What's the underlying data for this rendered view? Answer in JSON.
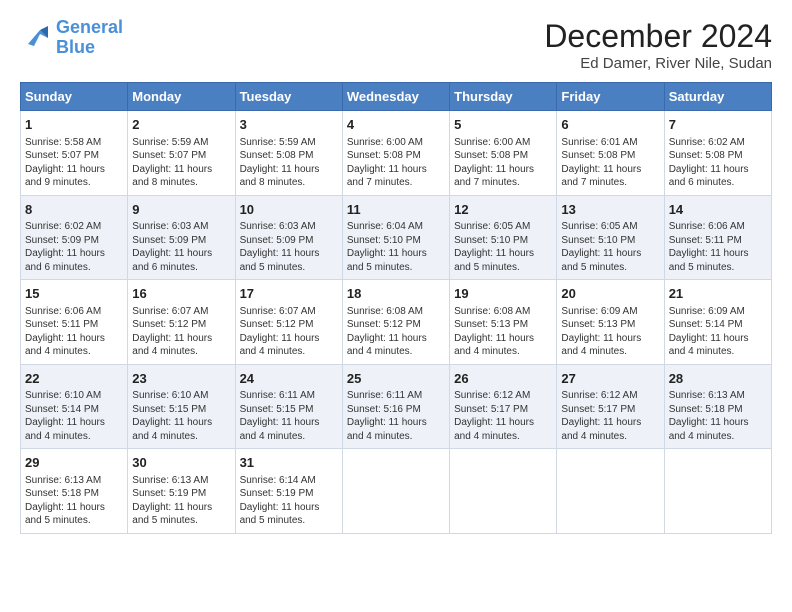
{
  "logo": {
    "line1": "General",
    "line2": "Blue"
  },
  "title": "December 2024",
  "subtitle": "Ed Damer, River Nile, Sudan",
  "days_of_week": [
    "Sunday",
    "Monday",
    "Tuesday",
    "Wednesday",
    "Thursday",
    "Friday",
    "Saturday"
  ],
  "weeks": [
    [
      {
        "day": "1",
        "info": "Sunrise: 5:58 AM\nSunset: 5:07 PM\nDaylight: 11 hours and 9 minutes."
      },
      {
        "day": "2",
        "info": "Sunrise: 5:59 AM\nSunset: 5:07 PM\nDaylight: 11 hours and 8 minutes."
      },
      {
        "day": "3",
        "info": "Sunrise: 5:59 AM\nSunset: 5:08 PM\nDaylight: 11 hours and 8 minutes."
      },
      {
        "day": "4",
        "info": "Sunrise: 6:00 AM\nSunset: 5:08 PM\nDaylight: 11 hours and 7 minutes."
      },
      {
        "day": "5",
        "info": "Sunrise: 6:00 AM\nSunset: 5:08 PM\nDaylight: 11 hours and 7 minutes."
      },
      {
        "day": "6",
        "info": "Sunrise: 6:01 AM\nSunset: 5:08 PM\nDaylight: 11 hours and 7 minutes."
      },
      {
        "day": "7",
        "info": "Sunrise: 6:02 AM\nSunset: 5:08 PM\nDaylight: 11 hours and 6 minutes."
      }
    ],
    [
      {
        "day": "8",
        "info": "Sunrise: 6:02 AM\nSunset: 5:09 PM\nDaylight: 11 hours and 6 minutes."
      },
      {
        "day": "9",
        "info": "Sunrise: 6:03 AM\nSunset: 5:09 PM\nDaylight: 11 hours and 6 minutes."
      },
      {
        "day": "10",
        "info": "Sunrise: 6:03 AM\nSunset: 5:09 PM\nDaylight: 11 hours and 5 minutes."
      },
      {
        "day": "11",
        "info": "Sunrise: 6:04 AM\nSunset: 5:10 PM\nDaylight: 11 hours and 5 minutes."
      },
      {
        "day": "12",
        "info": "Sunrise: 6:05 AM\nSunset: 5:10 PM\nDaylight: 11 hours and 5 minutes."
      },
      {
        "day": "13",
        "info": "Sunrise: 6:05 AM\nSunset: 5:10 PM\nDaylight: 11 hours and 5 minutes."
      },
      {
        "day": "14",
        "info": "Sunrise: 6:06 AM\nSunset: 5:11 PM\nDaylight: 11 hours and 5 minutes."
      }
    ],
    [
      {
        "day": "15",
        "info": "Sunrise: 6:06 AM\nSunset: 5:11 PM\nDaylight: 11 hours and 4 minutes."
      },
      {
        "day": "16",
        "info": "Sunrise: 6:07 AM\nSunset: 5:12 PM\nDaylight: 11 hours and 4 minutes."
      },
      {
        "day": "17",
        "info": "Sunrise: 6:07 AM\nSunset: 5:12 PM\nDaylight: 11 hours and 4 minutes."
      },
      {
        "day": "18",
        "info": "Sunrise: 6:08 AM\nSunset: 5:12 PM\nDaylight: 11 hours and 4 minutes."
      },
      {
        "day": "19",
        "info": "Sunrise: 6:08 AM\nSunset: 5:13 PM\nDaylight: 11 hours and 4 minutes."
      },
      {
        "day": "20",
        "info": "Sunrise: 6:09 AM\nSunset: 5:13 PM\nDaylight: 11 hours and 4 minutes."
      },
      {
        "day": "21",
        "info": "Sunrise: 6:09 AM\nSunset: 5:14 PM\nDaylight: 11 hours and 4 minutes."
      }
    ],
    [
      {
        "day": "22",
        "info": "Sunrise: 6:10 AM\nSunset: 5:14 PM\nDaylight: 11 hours and 4 minutes."
      },
      {
        "day": "23",
        "info": "Sunrise: 6:10 AM\nSunset: 5:15 PM\nDaylight: 11 hours and 4 minutes."
      },
      {
        "day": "24",
        "info": "Sunrise: 6:11 AM\nSunset: 5:15 PM\nDaylight: 11 hours and 4 minutes."
      },
      {
        "day": "25",
        "info": "Sunrise: 6:11 AM\nSunset: 5:16 PM\nDaylight: 11 hours and 4 minutes."
      },
      {
        "day": "26",
        "info": "Sunrise: 6:12 AM\nSunset: 5:17 PM\nDaylight: 11 hours and 4 minutes."
      },
      {
        "day": "27",
        "info": "Sunrise: 6:12 AM\nSunset: 5:17 PM\nDaylight: 11 hours and 4 minutes."
      },
      {
        "day": "28",
        "info": "Sunrise: 6:13 AM\nSunset: 5:18 PM\nDaylight: 11 hours and 4 minutes."
      }
    ],
    [
      {
        "day": "29",
        "info": "Sunrise: 6:13 AM\nSunset: 5:18 PM\nDaylight: 11 hours and 5 minutes."
      },
      {
        "day": "30",
        "info": "Sunrise: 6:13 AM\nSunset: 5:19 PM\nDaylight: 11 hours and 5 minutes."
      },
      {
        "day": "31",
        "info": "Sunrise: 6:14 AM\nSunset: 5:19 PM\nDaylight: 11 hours and 5 minutes."
      },
      {
        "day": "",
        "info": ""
      },
      {
        "day": "",
        "info": ""
      },
      {
        "day": "",
        "info": ""
      },
      {
        "day": "",
        "info": ""
      }
    ]
  ]
}
